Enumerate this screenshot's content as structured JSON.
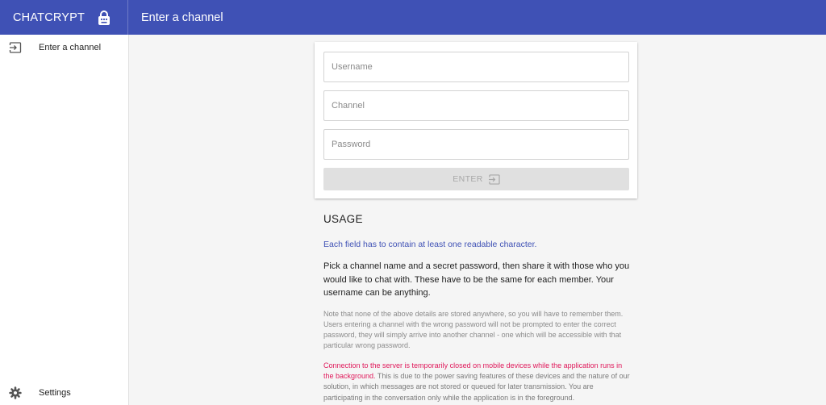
{
  "app": {
    "name": "CHATCRYPT",
    "brand_icon": "lock-icon"
  },
  "header": {
    "title": "Enter a channel"
  },
  "sidebar": {
    "items": [
      {
        "label": "Enter a channel",
        "icon": "login-icon"
      },
      {
        "label": "Settings",
        "icon": "gear-icon"
      }
    ]
  },
  "form": {
    "username_placeholder": "Username",
    "channel_placeholder": "Channel",
    "password_placeholder": "Password",
    "username_value": "",
    "channel_value": "",
    "password_value": "",
    "enter_label": "ENTER",
    "enter_icon": "login-icon",
    "enter_disabled": true
  },
  "usage": {
    "heading": "USAGE",
    "rule": "Each field has to contain at least one readable character.",
    "main": "Pick a channel name and a secret password, then share it with those who you would like to chat with. These have to be the same for each member. Your username can be anything.",
    "note": "Note that none of the above details are stored anywhere, so you will have to remember them. Users entering a channel with the wrong password will not be prompted to enter the correct password, they will simply arrive into another channel - one which will be accessible with that particular wrong password.",
    "warning_highlight": "Connection to the server is temporarily closed on mobile devices while the application runs in the background.",
    "warning_rest": " This is due to the power saving features of these devices and the nature of our solution, in which messages are not stored or queued for later transmission. You are participating in the conversation only while the application is in the foreground."
  },
  "colors": {
    "primary": "#3f51b5",
    "warning": "#e0185a",
    "background": "#f5f5f5"
  }
}
